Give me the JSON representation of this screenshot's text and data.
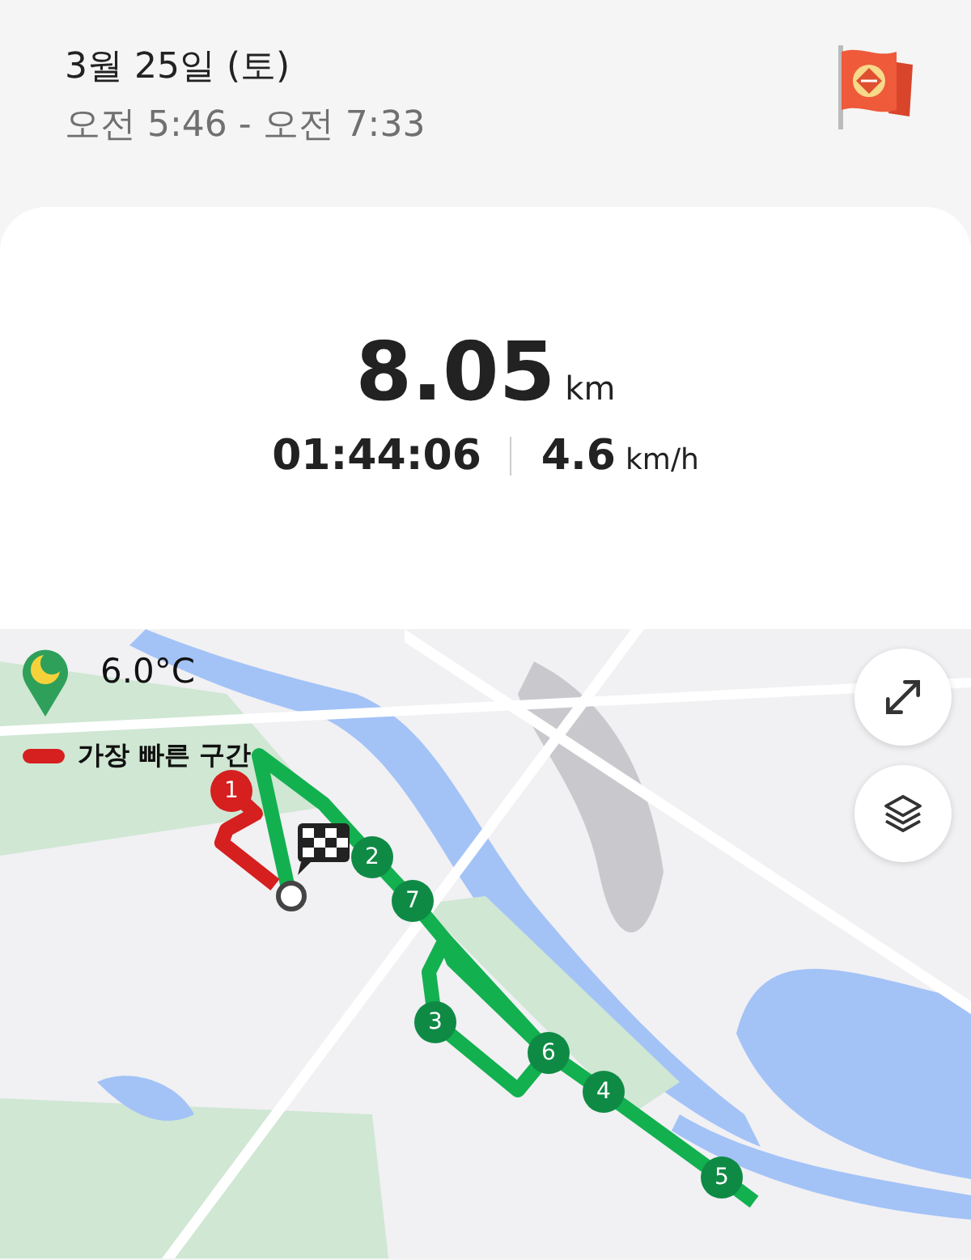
{
  "header": {
    "date": "3월 25일 (토)",
    "time_range": "오전 5:46 - 오전 7:33"
  },
  "summary": {
    "distance": "8.05",
    "distance_unit": "km",
    "duration": "01:44:06",
    "speed": "4.6",
    "speed_unit": "km/h"
  },
  "map": {
    "weather": {
      "temperature": "6.0°C"
    },
    "legend": {
      "label": "가장 빠른 구간"
    },
    "route_markers": [
      {
        "label": "1",
        "kind": "fastest"
      },
      {
        "label": "2",
        "kind": "normal"
      },
      {
        "label": "7",
        "kind": "normal"
      },
      {
        "label": "3",
        "kind": "normal"
      },
      {
        "label": "6",
        "kind": "normal"
      },
      {
        "label": "4",
        "kind": "normal"
      },
      {
        "label": "5",
        "kind": "normal"
      }
    ]
  }
}
